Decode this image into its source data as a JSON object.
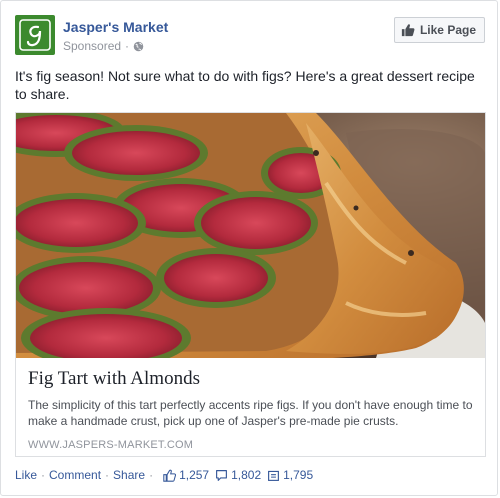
{
  "page": {
    "name": "Jasper's Market",
    "sponsored": "Sponsored",
    "avatar_icon": "jasper-logo-icon",
    "brand_color": "#3c8a2e"
  },
  "like_page_button": {
    "label": "Like Page",
    "icon": "thumbs-up-icon"
  },
  "post": {
    "text": "It's fig season! Not sure what to do with figs? Here's a great dessert recipe to share."
  },
  "attachment": {
    "title": "Fig Tart with Almonds",
    "description": "The simplicity of this tart perfectly accents ripe figs. If you don't have enough time to make a handmade crust, pick up one of Jasper's pre-made pie crusts.",
    "domain": "WWW.JASPERS-MARKET.COM"
  },
  "actions": {
    "like": "Like",
    "comment": "Comment",
    "share": "Share",
    "separator": "·"
  },
  "stats": {
    "likes": "1,257",
    "comments": "1,802",
    "shares": "1,795"
  }
}
